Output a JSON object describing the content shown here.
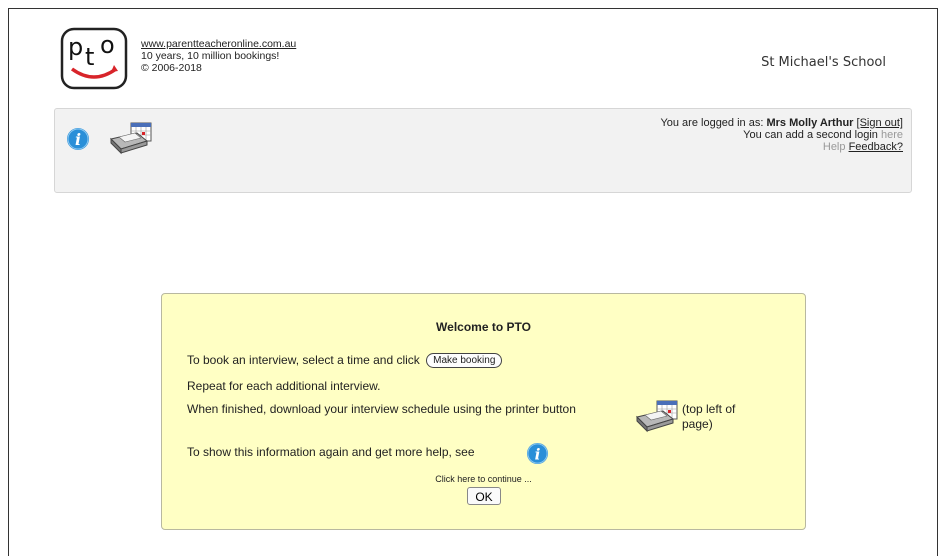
{
  "header": {
    "logo_text": "pto",
    "site_url": "www.parentteacheronline.com.au",
    "tagline": "10 years, 10 million bookings!",
    "copyright": "© 2006-2018",
    "school_name": "St Michael's School"
  },
  "toolbar": {
    "info_icon": "info-icon",
    "printer_icon": "printer-calendar-icon",
    "login_prefix": "You are logged in as:",
    "user_name": "Mrs Molly Arthur",
    "sign_out": "[Sign out]",
    "second_login_text": "You can add a second login",
    "second_login_link": "here",
    "help": "Help",
    "feedback": "Feedback?"
  },
  "dialog": {
    "title": "Welcome to PTO",
    "line1": "To book an interview, select a time and click",
    "make_booking_label": "Make booking",
    "line2": "Repeat for each additional interview.",
    "line3": "When finished, download your interview schedule using the printer button",
    "top_left_note": "(top left of page)",
    "line4": "To show this information again and get more help, see",
    "continue_text": "Click here to continue ...",
    "ok_label": "OK"
  },
  "colors": {
    "dialog_bg": "#ffffc4",
    "toolbar_bg": "#f2f2f2",
    "info_blue": "#2a8fd8",
    "logo_red": "#d8242a"
  }
}
